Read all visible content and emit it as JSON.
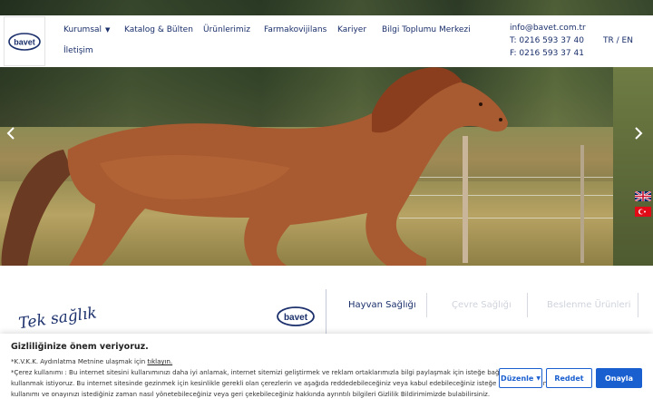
{
  "brand": {
    "logo_text": "bavet"
  },
  "nav": {
    "items": [
      {
        "label": "Kurumsal",
        "has_dropdown": true
      },
      {
        "label": "Katalog & Bülten"
      },
      {
        "label": "Ürünlerimiz"
      },
      {
        "label": "Farmakovijilans"
      },
      {
        "label": "Kariyer"
      },
      {
        "label": "Bilgi Toplumu Merkezi"
      },
      {
        "label": "İletişim"
      }
    ]
  },
  "contact": {
    "email": "info@bavet.com.tr",
    "phone": "T: 0216 593 37 40",
    "fax": "F: 0216 593 37 41"
  },
  "language": {
    "label": "TR / EN"
  },
  "hero": {
    "prev_icon": "chevron-left-icon",
    "next_icon": "chevron-right-icon"
  },
  "tagline": {
    "text": "Tek sağlık!"
  },
  "tabs": [
    {
      "label": "Hayvan Sağlığı",
      "active": true
    },
    {
      "label": "Çevre Sağlığı",
      "active": false
    },
    {
      "label": "Beslenme Ürünleri",
      "active": false
    }
  ],
  "cookie": {
    "title": "Gizliliğinize önem veriyoruz.",
    "kvkk_prefix": "*K.V.K.K. Aydınlatma Metnine ulaşmak için ",
    "kvkk_link": "tıklayın.",
    "line1": "*Çerez kullanımı : Bu internet sitesini kullanımınızı daha iyi anlamak, internet sitemizi geliştirmek ve reklam ortaklarımızla bilgi paylaşmak için isteğe bağlı çerezler",
    "line2": "kullanmak istiyoruz. Bu internet sitesinde gezinmek için kesinlikle gerekli olan çerezlerin ve aşağıda reddedebileceğiniz veya kabul edebileceğiniz isteğe bağlı çerezlerin",
    "line3": "kullanımı ve onayınızı istediğiniz zaman nasıl yönetebileceğiniz veya geri çekebileceğiniz hakkında ayrıntılı bilgileri Gizlilik Bildirimimizde bulabilirsiniz.",
    "settings_label": "Düzenle",
    "reject_label": "Reddet",
    "accept_label": "Onayla"
  },
  "colors": {
    "brand_navy": "#1a2f6b",
    "accent_blue": "#1a5fd0"
  }
}
